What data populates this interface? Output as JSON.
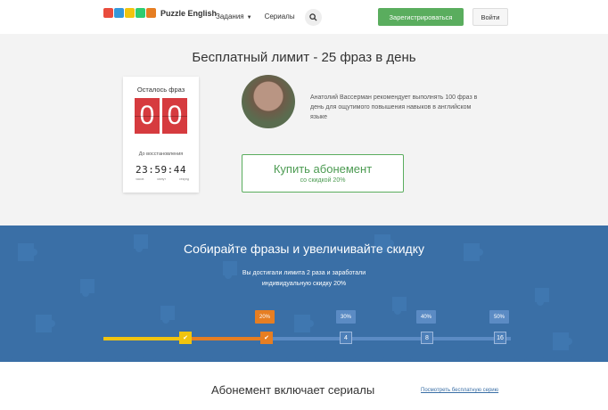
{
  "header": {
    "logo_text": "Puzzle English",
    "logo_colors": [
      "#e94c3d",
      "#3498db",
      "#f1c40f",
      "#2ecc71",
      "#e67e22"
    ],
    "nav": [
      "Задания",
      "Сериалы"
    ],
    "register_label": "Зарегистрироваться",
    "login_label": "Войти",
    "accent": "#5aad5e"
  },
  "limit": {
    "title": "Бесплатный лимит - 25 фраз в день",
    "counter_label": "Осталось фраз",
    "digits": [
      "0",
      "0"
    ],
    "reset_label": "До восстановления",
    "timer": "23:59:44",
    "timer_units": [
      "часов",
      "минут",
      "секунд"
    ],
    "quote": "Анатолий Вассерман рекомендует выполнять 100 фраз в день для ощутимого повышения навыков в английском языке",
    "buy_label": "Купить абонемент",
    "buy_sub": "со скидкой 20%"
  },
  "discount": {
    "title": "Собирайте фразы и увеличивайте скидку",
    "text_line1": "Вы достигали лимита 2 раза и заработали",
    "text_line2": "индивидуальную скидку 20%",
    "milestones": [
      {
        "badge": "",
        "label": "",
        "done": true
      },
      {
        "badge": "20%",
        "label": "",
        "done": true
      },
      {
        "badge": "30%",
        "label": "4",
        "done": false
      },
      {
        "badge": "40%",
        "label": "8",
        "done": false
      },
      {
        "badge": "50%",
        "label": "16",
        "done": false
      }
    ],
    "bg_color": "#3a6fa6"
  },
  "bottom": {
    "title": "Абонемент включает сериалы",
    "link": "Посмотреть бесплатную серию"
  }
}
